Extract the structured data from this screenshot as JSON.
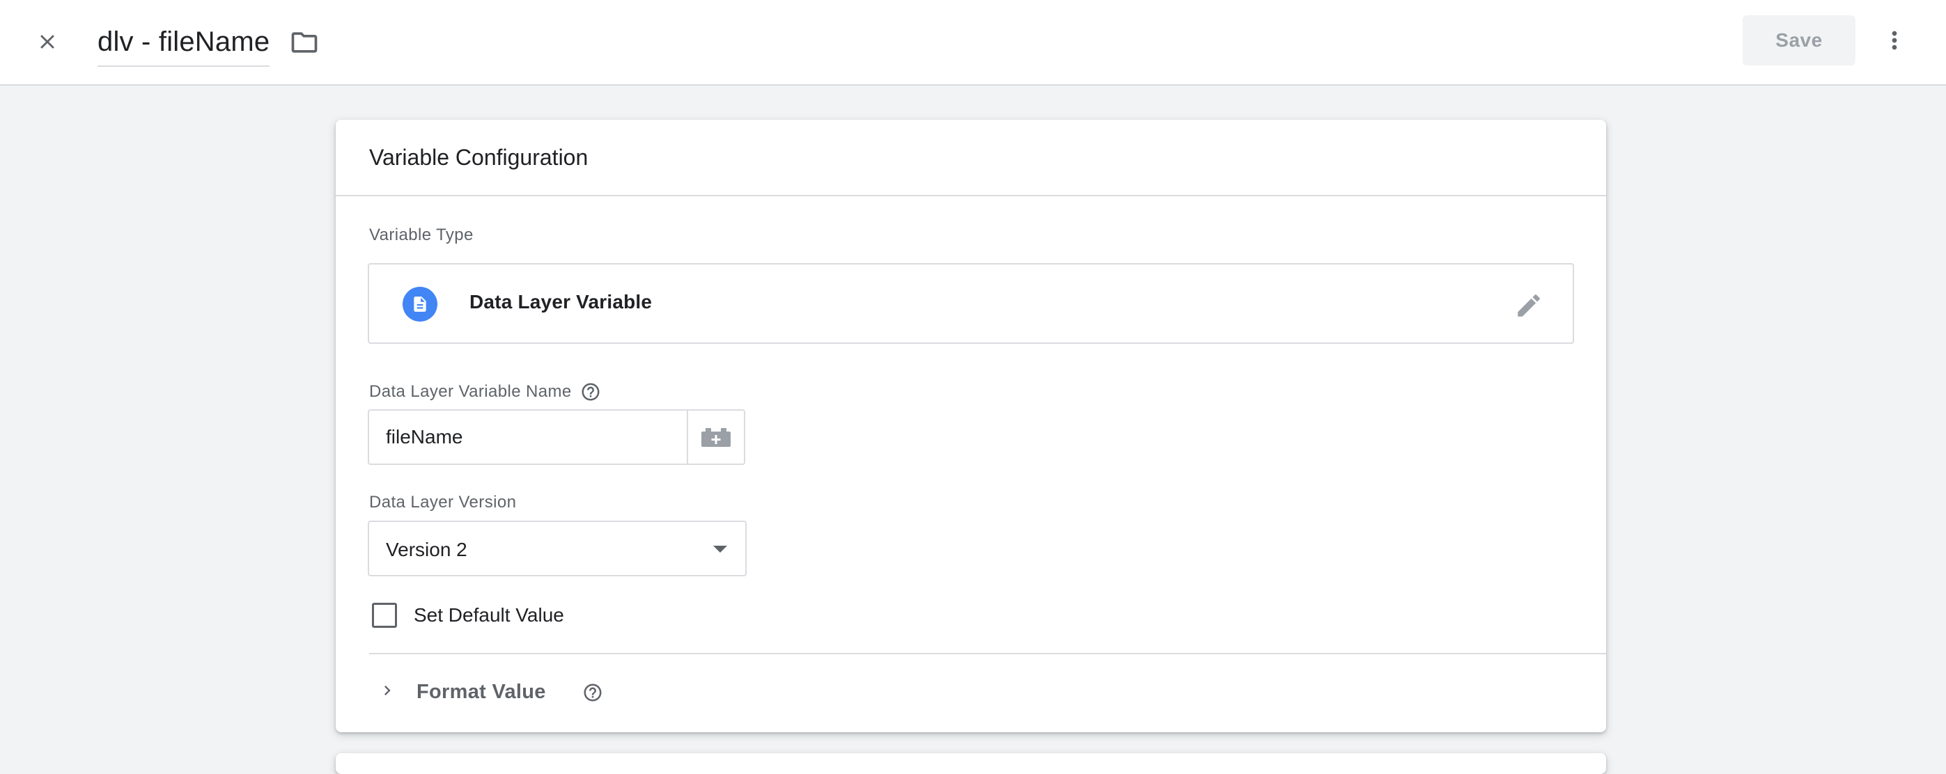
{
  "header": {
    "title": "dlv - fileName",
    "save_label": "Save",
    "icons": {
      "close": "close-icon",
      "folder": "folder-icon",
      "more": "more-vert-icon"
    }
  },
  "card": {
    "title": "Variable Configuration",
    "variable_type": {
      "label": "Variable Type",
      "name": "Data Layer Variable",
      "icon": "document-icon",
      "icon_color": "#4285f4",
      "edit_icon": "pencil-icon"
    },
    "variable_name": {
      "label": "Data Layer Variable Name",
      "value": "fileName",
      "help_icon": "help-icon",
      "picker_icon": "add-variable-icon"
    },
    "version": {
      "label": "Data Layer Version",
      "selected": "Version 2"
    },
    "default_value": {
      "label": "Set Default Value",
      "checked": false
    },
    "format_value": {
      "label": "Format Value",
      "expanded": false
    }
  },
  "colors": {
    "background": "#f1f3f4",
    "accent_blue": "#4285f4",
    "border": "#dadce0",
    "text_secondary": "#5f6368"
  }
}
